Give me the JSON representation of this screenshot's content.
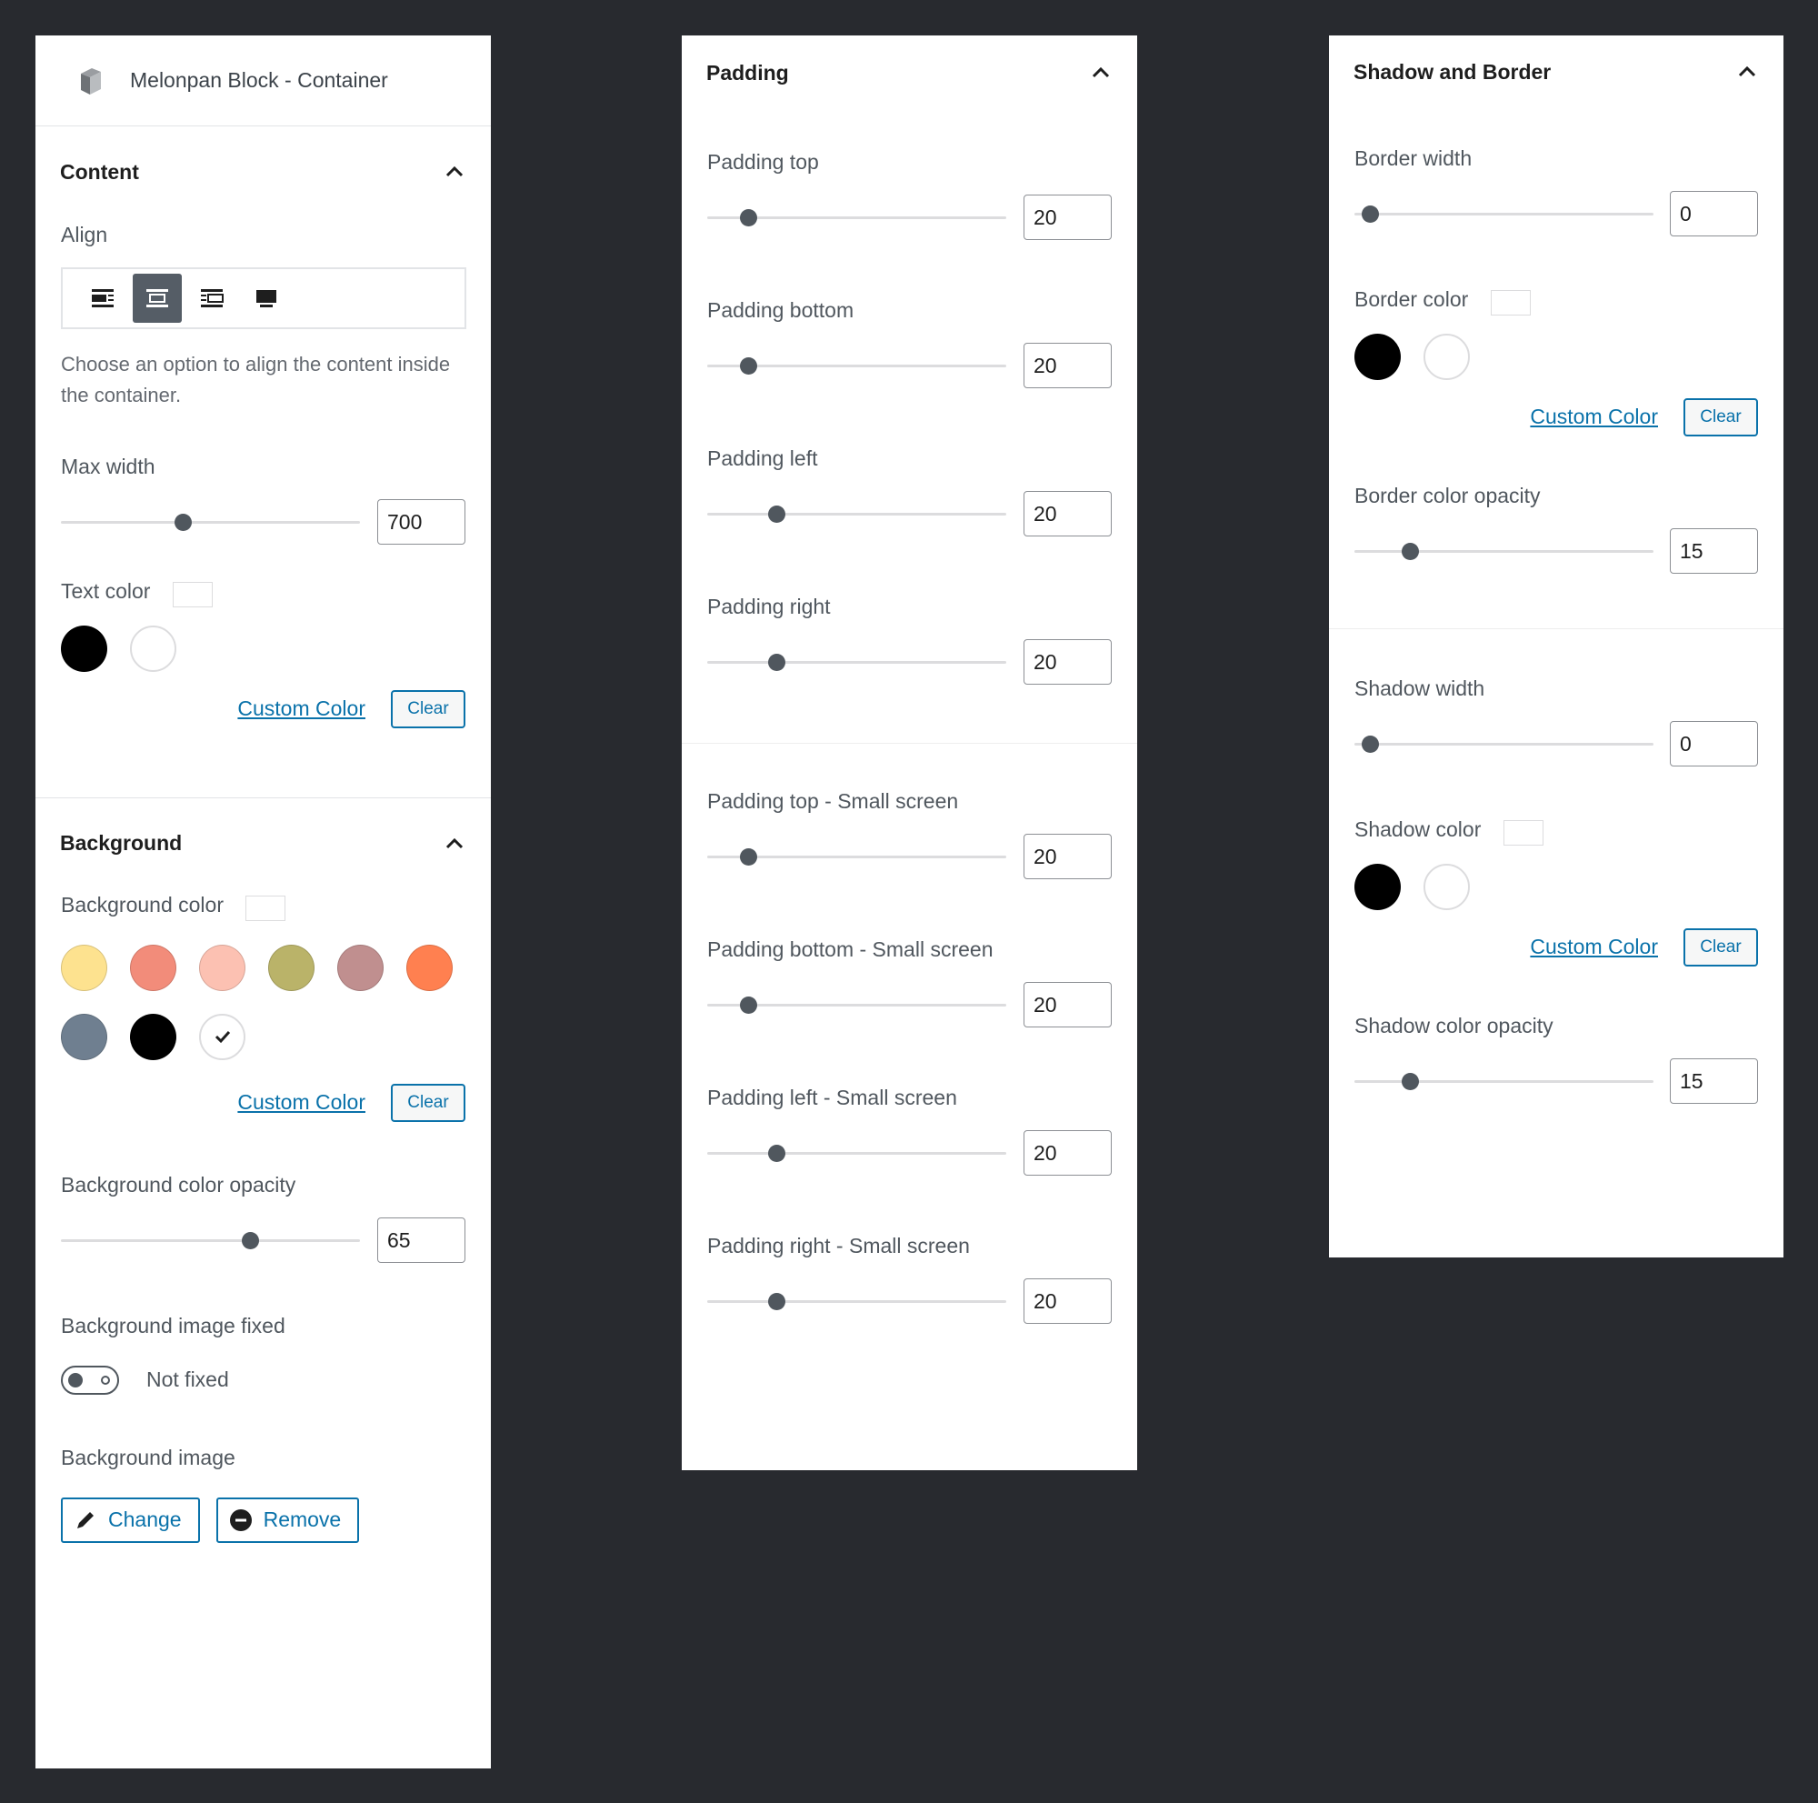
{
  "left": {
    "block_title": "Melonpan Block - Container",
    "content": {
      "title": "Content",
      "align_label": "Align",
      "align_help": "Choose an option to align the content inside the container.",
      "max_width_label": "Max width",
      "max_width_value": "700",
      "max_width_fraction": 0.42,
      "text_color_label": "Text color",
      "custom_color": "Custom Color",
      "clear": "Clear"
    },
    "background": {
      "title": "Background",
      "color_label": "Background color",
      "custom_color": "Custom Color",
      "clear": "Clear",
      "opacity_label": "Background color opacity",
      "opacity_value": "65",
      "fixed_label": "Background image fixed",
      "fixed_state": "Not fixed",
      "image_label": "Background image",
      "change": "Change",
      "remove": "Remove"
    },
    "palette": [
      "#fde28f",
      "#f28c7a",
      "#fcc1b2",
      "#bab369",
      "#c08f8f",
      "#ff8050",
      "#6f7f90",
      "#000000",
      "#ffffff"
    ]
  },
  "mid": {
    "title": "Padding",
    "fields": [
      {
        "label": "Padding top",
        "value": "20"
      },
      {
        "label": "Padding bottom",
        "value": "20"
      },
      {
        "label": "Padding left",
        "value": "20"
      },
      {
        "label": "Padding right",
        "value": "20"
      },
      {
        "label": "Padding top - Small screen",
        "value": "20"
      },
      {
        "label": "Padding bottom - Small screen",
        "value": "20"
      },
      {
        "label": "Padding left - Small screen",
        "value": "20"
      },
      {
        "label": "Padding right - Small screen",
        "value": "20"
      }
    ]
  },
  "right": {
    "title": "Shadow and Border",
    "border_width_label": "Border width",
    "border_width_value": "0",
    "border_color_label": "Border color",
    "custom_color": "Custom Color",
    "clear": "Clear",
    "border_opacity_label": "Border color opacity",
    "border_opacity_value": "15",
    "shadow_width_label": "Shadow width",
    "shadow_width_value": "0",
    "shadow_color_label": "Shadow color",
    "shadow_opacity_label": "Shadow color opacity",
    "shadow_opacity_value": "15"
  }
}
